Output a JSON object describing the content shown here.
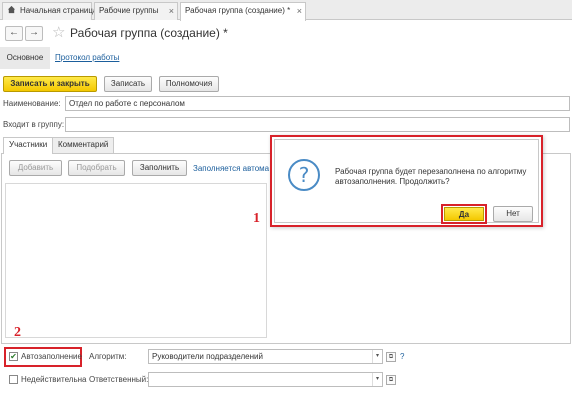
{
  "tabs": [
    {
      "label": "Начальная страница",
      "icon": "home-icon"
    },
    {
      "label": "Рабочие группы"
    },
    {
      "label": "Рабочая группа (создание) *",
      "active": true
    }
  ],
  "close_glyph": "×",
  "nav": {
    "back": "←",
    "forward": "→",
    "star": "☆"
  },
  "title": "Рабочая группа (создание) *",
  "sections": {
    "main": "Основное",
    "link": "Протокол работы"
  },
  "toolbar": {
    "save_close": "Записать и закрыть",
    "save": "Записать",
    "permissions": "Полномочия"
  },
  "form": {
    "name_label": "Наименование:",
    "name_value": "Отдел по работе с персоналом",
    "group_label": "Входит в группу:",
    "group_value": ""
  },
  "inner_tabs": [
    "Участники",
    "Комментарий"
  ],
  "participants": {
    "add": "Добавить",
    "pick": "Подобрать",
    "fill": "Заполнить",
    "autofill_note": "Заполняется автома"
  },
  "dialog": {
    "icon": "?",
    "text": "Рабочая группа будет перезаполнена по алгоритму автозаполнения. Продолжить?",
    "yes": "Да",
    "no": "Нет"
  },
  "markers": {
    "one": "1",
    "two": "2"
  },
  "bottom": {
    "autofill_label": "Автозаполнение",
    "autofill_checked": true,
    "check_glyph": "✔",
    "algorithm_label": "Алгоритм:",
    "algorithm_value": "Руководители подразделений",
    "help": "?",
    "invalid_label": "Недействительна",
    "invalid_checked": false,
    "responsible_label": "Ответственный:",
    "responsible_value": "",
    "dropdown_glyph": "▾",
    "open_glyph": "⧉"
  },
  "colors": {
    "accent_yellow": "#f4c800",
    "highlight_red": "#d8222a",
    "link_blue": "#1b5e9c"
  }
}
